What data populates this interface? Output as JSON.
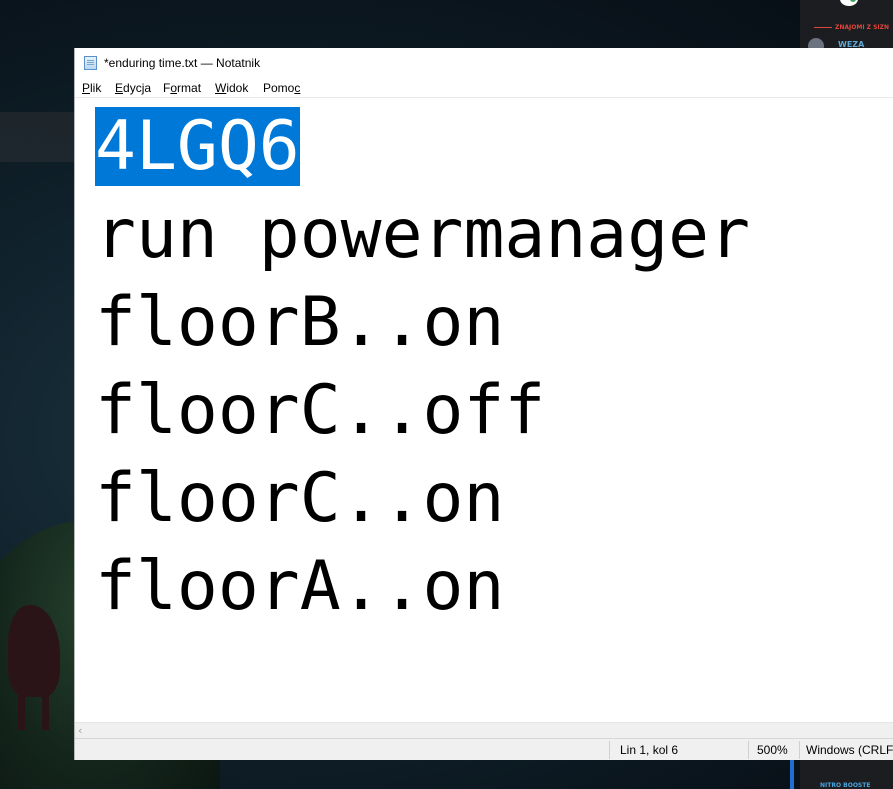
{
  "window": {
    "title": "*enduring time.txt — Notatnik",
    "icon": "notepad-icon"
  },
  "menu": {
    "items": [
      {
        "label_u": "P",
        "label_rest": "lik"
      },
      {
        "label_u": "E",
        "label_rest": "dycja"
      },
      {
        "label_pre": "F",
        "label_u": "o",
        "label_rest": "rmat"
      },
      {
        "label_u": "W",
        "label_rest": "idok"
      },
      {
        "label_pre": "Pomo",
        "label_u": "c",
        "label_rest": ""
      }
    ]
  },
  "editor": {
    "selected_text": "4LGQ6",
    "lines": [
      "run powermanager",
      "floorB..on",
      "floorC..off",
      "floorC..on",
      "floorA..on"
    ],
    "selection_color": "#0078d7"
  },
  "status": {
    "position": "Lin 1, kol 6",
    "zoom": "500%",
    "line_ending": "Windows (CRLF)"
  },
  "background_app": {
    "section_label": "ZNAJOMI Z SIZN",
    "user_name": "WEZA",
    "boost_label": "NITRO BOOSTE"
  }
}
